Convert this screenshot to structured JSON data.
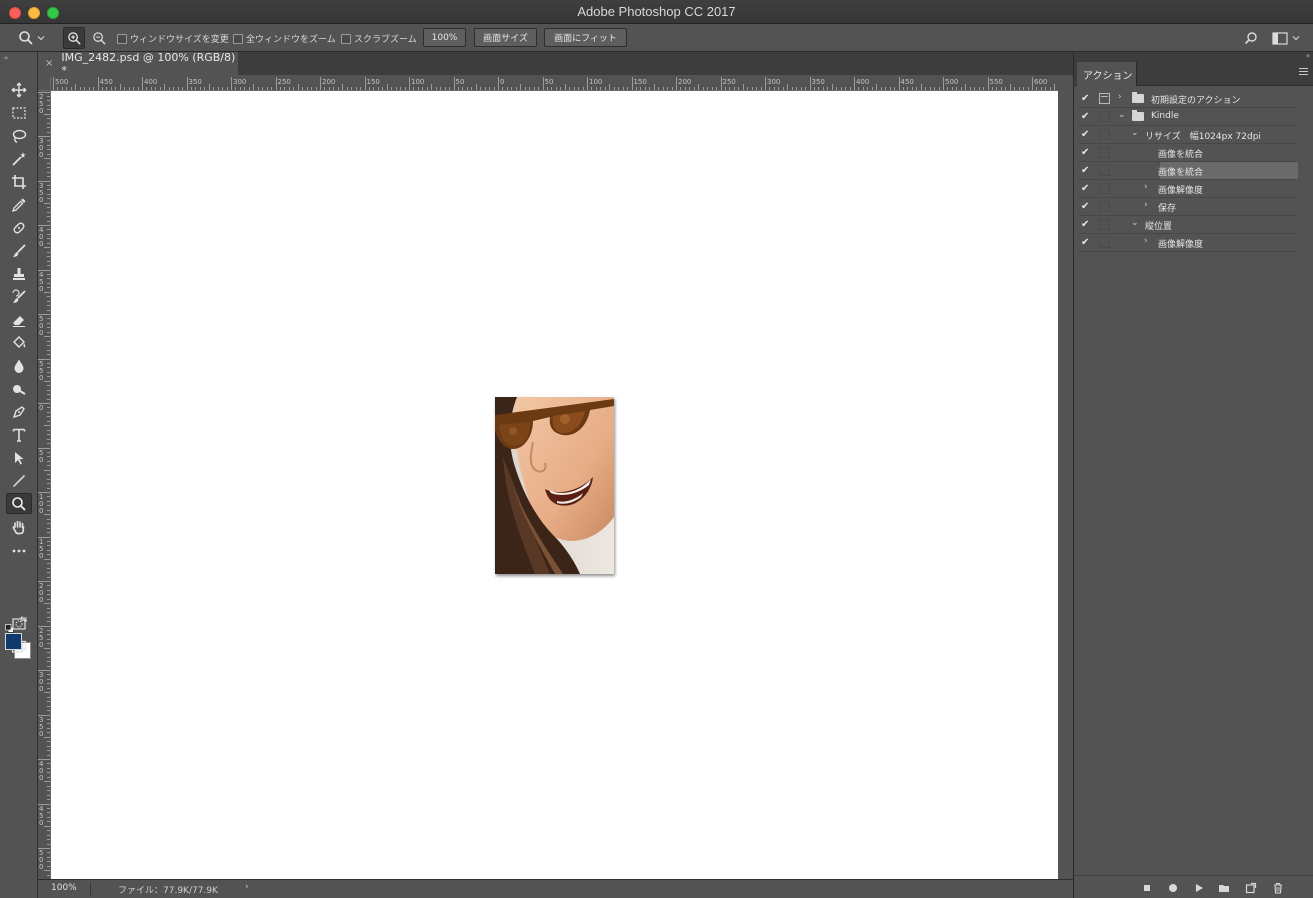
{
  "window": {
    "title": "Adobe Photoshop CC 2017"
  },
  "options_bar": {
    "resize_windows_label": "ウィンドウサイズを変更",
    "zoom_all_windows_label": "全ウィンドウをズーム",
    "scrubby_zoom_label": "スクラブズーム",
    "zoom_100_label": "100%",
    "fit_screen_label": "画面サイズ",
    "fill_screen_label": "画面にフィット"
  },
  "document": {
    "tab_title": "IMG_2482.psd @ 100% (RGB/8) *",
    "close_glyph": "×"
  },
  "ruler": {
    "h_labels": [
      "500",
      "450",
      "400",
      "350",
      "300",
      "250",
      "200",
      "150",
      "100",
      "50",
      "0",
      "50",
      "100",
      "150",
      "200",
      "250",
      "300",
      "350",
      "400",
      "450",
      "500",
      "550",
      "600"
    ],
    "v_labels": [
      "50",
      "100",
      "150",
      "200",
      "250",
      "300",
      "350",
      "400",
      "450",
      "500",
      "550",
      "0",
      "50",
      "100",
      "150",
      "200",
      "250",
      "300",
      "350",
      "400",
      "450",
      "500",
      "550"
    ]
  },
  "status_bar": {
    "zoom": "100%",
    "file_info": "ファイル：77.9K/77.9K",
    "arrow": "›"
  },
  "actions_panel": {
    "tab_label": "アクション",
    "rows": [
      {
        "check": "✔",
        "dialog": true,
        "indent": 0,
        "expanded": false,
        "folder": true,
        "label": "初期設定のアクション"
      },
      {
        "check": "✔",
        "dialog": false,
        "indent": 0,
        "expanded": true,
        "folder": true,
        "label": "Kindle"
      },
      {
        "check": "✔",
        "dialog": false,
        "indent": 1,
        "expanded": true,
        "folder": false,
        "label": "リサイズ　幅1024px 72dpi"
      },
      {
        "check": "✔",
        "dialog": false,
        "indent": 2,
        "expanded": null,
        "folder": false,
        "label": "画像を統合"
      },
      {
        "check": "✔",
        "dialog": false,
        "indent": 2,
        "expanded": null,
        "folder": false,
        "label": "画像を統合",
        "selected": true
      },
      {
        "check": "✔",
        "dialog": false,
        "indent": 2,
        "expanded": false,
        "folder": false,
        "label": "画像解像度"
      },
      {
        "check": "✔",
        "dialog": false,
        "indent": 2,
        "expanded": false,
        "folder": false,
        "label": "保存"
      },
      {
        "check": "✔",
        "dialog": false,
        "indent": 1,
        "expanded": true,
        "folder": false,
        "label": "縦位置"
      },
      {
        "check": "✔",
        "dialog": false,
        "indent": 2,
        "expanded": false,
        "folder": false,
        "label": "画像解像度"
      }
    ]
  },
  "colors": {
    "foreground": "#0e3a6c",
    "background": "#ffffff",
    "ui_bg": "#535353",
    "canvas": "#ffffff"
  },
  "icons": {
    "toolbox": [
      "move-icon",
      "marquee-icon",
      "lasso-icon",
      "magic-wand-icon",
      "crop-icon",
      "eyedropper-icon",
      "healing-brush-icon",
      "brush-icon",
      "clone-stamp-icon",
      "history-brush-icon",
      "eraser-icon",
      "paint-bucket-icon",
      "blur-icon",
      "dodge-icon",
      "pen-icon",
      "type-icon",
      "path-selection-icon",
      "line-icon",
      "zoom-icon",
      "hand-icon",
      "more-tools-icon"
    ]
  }
}
